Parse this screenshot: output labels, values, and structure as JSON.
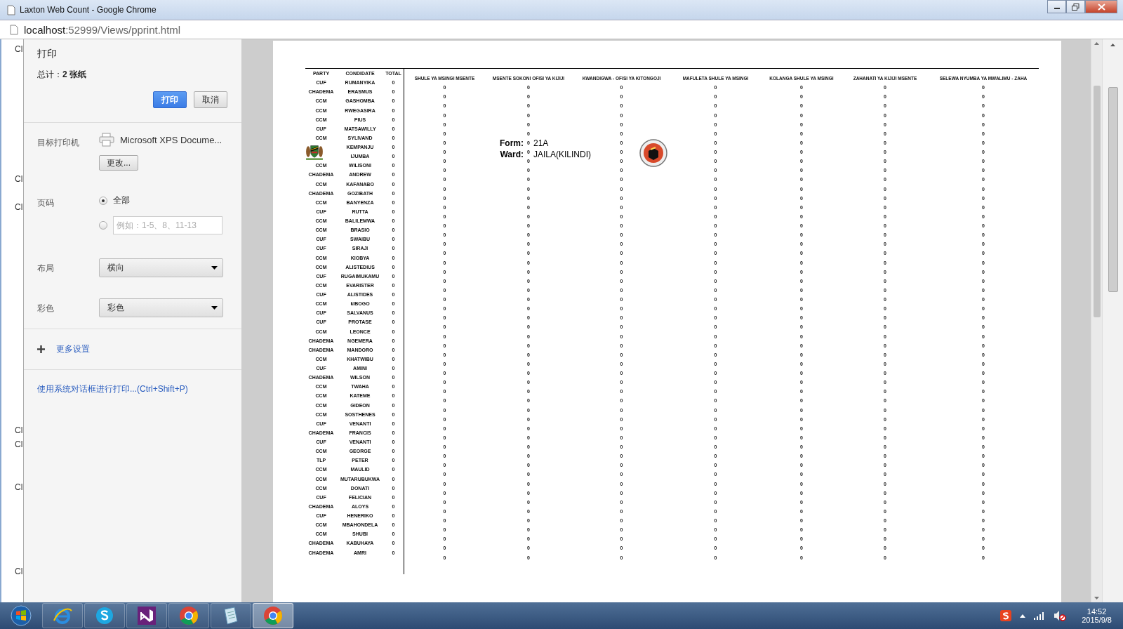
{
  "window": {
    "title": "Laxton Web Count - Google Chrome"
  },
  "address_bar": {
    "host": "localhost",
    "path": ":52999/Views/pprint.html"
  },
  "background_page_fragments": [
    "Cl",
    "Cl",
    "Cl",
    "Cl",
    "Cl",
    "Cl",
    "Cl"
  ],
  "print_panel": {
    "title": "打印",
    "total": "总计：**2 张纸**",
    "buttons": [
      {
        "label": "打印",
        "kind": "primary"
      },
      {
        "label": "取消",
        "kind": "secondary"
      }
    ],
    "destination": {
      "label": "目标打印机",
      "printer": "Microsoft XPS Docume...",
      "change_button": "更改..."
    },
    "pages": {
      "label": "页码",
      "options": [
        {
          "kind": "all",
          "label": "全部",
          "selected": true
        },
        {
          "kind": "range",
          "placeholder": "例如：1-5、8、11-13",
          "selected": false
        }
      ]
    },
    "layout": {
      "label": "布局",
      "value": "横向"
    },
    "color": {
      "label": "彩色",
      "value": "彩色"
    },
    "more_settings": "更多设置",
    "system_dialog_link": "使用系统对话框进行打印...(Ctrl+Shift+P)"
  },
  "preview": {
    "columns": {
      "party": "PARTY",
      "candidate": "CONDIDATE",
      "total": "TOTAL"
    },
    "stations": [
      "SHULE YA MSINGI MSENTE",
      "MSENTE SOKONI OFISI YA KIJIJI",
      "KWANDIGWA - OFISI YA KITONGOJI",
      "MAFULETA SHULE YA MSINGI",
      "KOLANGA SHULE YA MSINGI",
      "ZAHANATI YA KIJIJI MSENTE",
      "SELEWA NYUMBA YA MWALIMU - ZAHA"
    ],
    "form": {
      "form_label": "Form:",
      "form_value": "21A",
      "ward_label": "Ward:",
      "ward_value": "JAILA(KILINDI)"
    },
    "rows": [
      {
        "party": "CUF",
        "candidate": "RUMANYIKA",
        "total": "0",
        "stations": [
          "0",
          "0",
          "0",
          "0",
          "0",
          "0",
          "0"
        ]
      },
      {
        "party": "CHADEMA",
        "candidate": "ERASMUS",
        "total": "0",
        "stations": [
          "0",
          "0",
          "0",
          "0",
          "0",
          "0",
          "0"
        ]
      },
      {
        "party": "CCM",
        "candidate": "GASHOMBA",
        "total": "0",
        "stations": [
          "0",
          "0",
          "0",
          "0",
          "0",
          "0",
          "0"
        ]
      },
      {
        "party": "CCM",
        "candidate": "RWEGASIRA",
        "total": "0",
        "stations": [
          "0",
          "0",
          "0",
          "0",
          "0",
          "0",
          "0"
        ]
      },
      {
        "party": "CCM",
        "candidate": "PIUS",
        "total": "0",
        "stations": [
          "0",
          "0",
          "0",
          "0",
          "0",
          "0",
          "0"
        ]
      },
      {
        "party": "CUF",
        "candidate": "MATSAWILLY",
        "total": "0",
        "stations": [
          "0",
          "0",
          "0",
          "0",
          "0",
          "0",
          "0"
        ]
      },
      {
        "party": "CCM",
        "candidate": "SYLIVAND",
        "total": "0",
        "stations": [
          "0",
          "0",
          "0",
          "0",
          "0",
          "0",
          "0"
        ]
      },
      {
        "candidate": "KEMPANJU",
        "total": "0",
        "stations": [
          "0",
          "0",
          "0",
          "0",
          "0",
          "0",
          "0"
        ]
      },
      {
        "candidate": "IJUMBA",
        "total": "0",
        "stations": [
          "0",
          "0",
          "0",
          "0",
          "0",
          "0",
          "0"
        ]
      },
      {
        "party": "CCM",
        "candidate": "WILISONI",
        "total": "0",
        "stations": [
          "0",
          "0",
          "0",
          "0",
          "0",
          "0",
          "0"
        ]
      },
      {
        "party": "CHADEMA",
        "candidate": "ANDREW",
        "total": "0",
        "stations": [
          "0",
          "0",
          "0",
          "0",
          "0",
          "0",
          "0"
        ]
      },
      {
        "party": "CCM",
        "candidate": "KAFANABO",
        "total": "0",
        "stations": [
          "0",
          "0",
          "0",
          "0",
          "0",
          "0",
          "0"
        ]
      },
      {
        "party": "CHADEMA",
        "candidate": "GOZIBATH",
        "total": "0",
        "stations": [
          "0",
          "0",
          "0",
          "0",
          "0",
          "0",
          "0"
        ]
      },
      {
        "party": "CCM",
        "candidate": "BANYENZA",
        "total": "0",
        "stations": [
          "0",
          "0",
          "0",
          "0",
          "0",
          "0",
          "0"
        ]
      },
      {
        "party": "CUF",
        "candidate": "RUTTA",
        "total": "0",
        "stations": [
          "0",
          "0",
          "0",
          "0",
          "0",
          "0",
          "0"
        ]
      },
      {
        "party": "CCM",
        "candidate": "BALILEMWA",
        "total": "0",
        "stations": [
          "0",
          "0",
          "0",
          "0",
          "0",
          "0",
          "0"
        ]
      },
      {
        "party": "CCM",
        "candidate": "BRASIO",
        "total": "0",
        "stations": [
          "0",
          "0",
          "0",
          "0",
          "0",
          "0",
          "0"
        ]
      },
      {
        "party": "CUF",
        "candidate": "SWAIBU",
        "total": "0",
        "stations": [
          "0",
          "0",
          "0",
          "0",
          "0",
          "0",
          "0"
        ]
      },
      {
        "party": "CUF",
        "candidate": "SIRAJI",
        "total": "0",
        "stations": [
          "0",
          "0",
          "0",
          "0",
          "0",
          "0",
          "0"
        ]
      },
      {
        "party": "CCM",
        "candidate": "KIOBYA",
        "total": "0",
        "stations": [
          "0",
          "0",
          "0",
          "0",
          "0",
          "0",
          "0"
        ]
      },
      {
        "party": "CCM",
        "candidate": "ALISTEDIUS",
        "total": "0",
        "stations": [
          "0",
          "0",
          "0",
          "0",
          "0",
          "0",
          "0"
        ]
      },
      {
        "party": "CUF",
        "candidate": "RUGAIMUKAMU",
        "total": "0",
        "stations": [
          "0",
          "0",
          "0",
          "0",
          "0",
          "0",
          "0"
        ]
      },
      {
        "party": "CCM",
        "candidate": "EVARISTER",
        "total": "0",
        "stations": [
          "0",
          "0",
          "0",
          "0",
          "0",
          "0",
          "0"
        ]
      },
      {
        "party": "CUF",
        "candidate": "ALISTIDES",
        "total": "0",
        "stations": [
          "0",
          "0",
          "0",
          "0",
          "0",
          "0",
          "0"
        ]
      },
      {
        "party": "CCM",
        "candidate": "kIBOGO",
        "total": "0",
        "stations": [
          "0",
          "0",
          "0",
          "0",
          "0",
          "0",
          "0"
        ]
      },
      {
        "party": "CUF",
        "candidate": "SALVANUS",
        "total": "0",
        "stations": [
          "0",
          "0",
          "0",
          "0",
          "0",
          "0",
          "0"
        ]
      },
      {
        "party": "CUF",
        "candidate": "PROTASE",
        "total": "0",
        "stations": [
          "0",
          "0",
          "0",
          "0",
          "0",
          "0",
          "0"
        ]
      },
      {
        "party": "CCM",
        "candidate": "LEONCE",
        "total": "0",
        "stations": [
          "0",
          "0",
          "0",
          "0",
          "0",
          "0",
          "0"
        ]
      },
      {
        "party": "CHADEMA",
        "candidate": "NGEMERA",
        "total": "0",
        "stations": [
          "0",
          "0",
          "0",
          "0",
          "0",
          "0",
          "0"
        ]
      },
      {
        "party": "CHADEMA",
        "candidate": "MANDORO",
        "total": "0",
        "stations": [
          "0",
          "0",
          "0",
          "0",
          "0",
          "0",
          "0"
        ]
      },
      {
        "party": "CCM",
        "candidate": "KHATWIBU",
        "total": "0",
        "stations": [
          "0",
          "0",
          "0",
          "0",
          "0",
          "0",
          "0"
        ]
      },
      {
        "party": "CUF",
        "candidate": "AMINI",
        "total": "0",
        "stations": [
          "0",
          "0",
          "0",
          "0",
          "0",
          "0",
          "0"
        ]
      },
      {
        "party": "CHADEMA",
        "candidate": "WILSON",
        "total": "0",
        "stations": [
          "0",
          "0",
          "0",
          "0",
          "0",
          "0",
          "0"
        ]
      },
      {
        "party": "CCM",
        "candidate": "TWAHA",
        "total": "0",
        "stations": [
          "0",
          "0",
          "0",
          "0",
          "0",
          "0",
          "0"
        ]
      },
      {
        "party": "CCM",
        "candidate": "KATEME",
        "total": "0",
        "stations": [
          "0",
          "0",
          "0",
          "0",
          "0",
          "0",
          "0"
        ]
      },
      {
        "party": "CCM",
        "candidate": "GIDEON",
        "total": "0",
        "stations": [
          "0",
          "0",
          "0",
          "0",
          "0",
          "0",
          "0"
        ]
      },
      {
        "party": "CCM",
        "candidate": "SOSTHENES",
        "total": "0",
        "stations": [
          "0",
          "0",
          "0",
          "0",
          "0",
          "0",
          "0"
        ]
      },
      {
        "party": "CUF",
        "candidate": "VENANTI",
        "total": "0",
        "stations": [
          "0",
          "0",
          "0",
          "0",
          "0",
          "0",
          "0"
        ]
      },
      {
        "party": "CHADEMA",
        "candidate": "FRANCIS",
        "total": "0",
        "stations": [
          "0",
          "0",
          "0",
          "0",
          "0",
          "0",
          "0"
        ]
      },
      {
        "party": "CUF",
        "candidate": "VENANTI",
        "total": "0",
        "stations": [
          "0",
          "0",
          "0",
          "0",
          "0",
          "0",
          "0"
        ]
      },
      {
        "party": "CCM",
        "candidate": "GEORGE",
        "total": "0",
        "stations": [
          "0",
          "0",
          "0",
          "0",
          "0",
          "0",
          "0"
        ]
      },
      {
        "party": "TLP",
        "candidate": "PETER",
        "total": "0",
        "stations": [
          "0",
          "0",
          "0",
          "0",
          "0",
          "0",
          "0"
        ]
      },
      {
        "party": "CCM",
        "candidate": "MAULID",
        "total": "0",
        "stations": [
          "0",
          "0",
          "0",
          "0",
          "0",
          "0",
          "0"
        ]
      },
      {
        "party": "CCM",
        "candidate": "MUTARUBUKWA",
        "total": "0",
        "stations": [
          "0",
          "0",
          "0",
          "0",
          "0",
          "0",
          "0"
        ]
      },
      {
        "party": "CCM",
        "candidate": "DONATI",
        "total": "0",
        "stations": [
          "0",
          "0",
          "0",
          "0",
          "0",
          "0",
          "0"
        ]
      },
      {
        "party": "CUF",
        "candidate": "FELICIAN",
        "total": "0",
        "stations": [
          "0",
          "0",
          "0",
          "0",
          "0",
          "0",
          "0"
        ]
      },
      {
        "party": "CHADEMA",
        "candidate": "ALOYS",
        "total": "0",
        "stations": [
          "0",
          "0",
          "0",
          "0",
          "0",
          "0",
          "0"
        ]
      },
      {
        "party": "CUF",
        "candidate": "HENERIKO",
        "total": "0",
        "stations": [
          "0",
          "0",
          "0",
          "0",
          "0",
          "0",
          "0"
        ]
      },
      {
        "party": "CCM",
        "candidate": "MBAHONDELA",
        "total": "0",
        "stations": [
          "0",
          "0",
          "0",
          "0",
          "0",
          "0",
          "0"
        ]
      },
      {
        "party": "CCM",
        "candidate": "SHUBI",
        "total": "0",
        "stations": [
          "0",
          "0",
          "0",
          "0",
          "0",
          "0",
          "0"
        ]
      },
      {
        "party": "CHADEMA",
        "candidate": "KABUHAYA",
        "total": "0",
        "stations": [
          "0",
          "0",
          "0",
          "0",
          "0",
          "0",
          "0"
        ]
      },
      {
        "party": "CHADEMA",
        "candidate": "AMRI",
        "total": "0",
        "stations": [
          "0",
          "0",
          "0",
          "0",
          "0",
          "0",
          "0"
        ]
      }
    ]
  },
  "taskbar": {
    "apps": [
      {
        "kind": "ie",
        "selected": false
      },
      {
        "kind": "skype",
        "selected": false
      },
      {
        "kind": "vs",
        "selected": false
      },
      {
        "kind": "chrome",
        "selected": false
      },
      {
        "kind": "notepad",
        "selected": false
      },
      {
        "kind": "chrome",
        "selected": true
      }
    ],
    "time": "14:52",
    "date": "2015/9/8"
  }
}
